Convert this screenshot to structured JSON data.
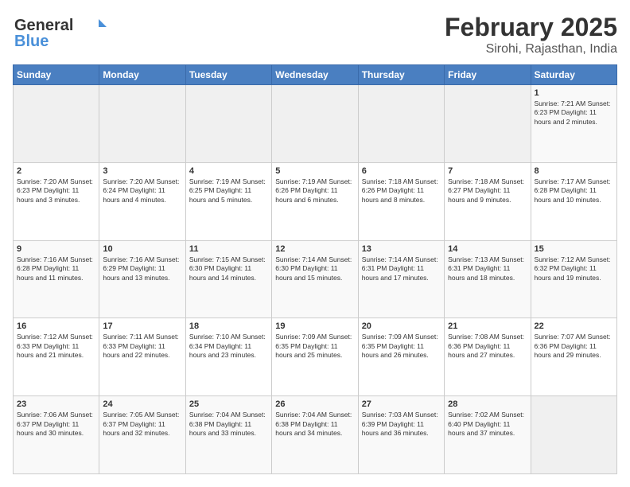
{
  "header": {
    "logo_line1": "General",
    "logo_line2": "Blue",
    "month": "February 2025",
    "location": "Sirohi, Rajasthan, India"
  },
  "weekdays": [
    "Sunday",
    "Monday",
    "Tuesday",
    "Wednesday",
    "Thursday",
    "Friday",
    "Saturday"
  ],
  "weeks": [
    [
      {
        "day": "",
        "info": ""
      },
      {
        "day": "",
        "info": ""
      },
      {
        "day": "",
        "info": ""
      },
      {
        "day": "",
        "info": ""
      },
      {
        "day": "",
        "info": ""
      },
      {
        "day": "",
        "info": ""
      },
      {
        "day": "1",
        "info": "Sunrise: 7:21 AM\nSunset: 6:23 PM\nDaylight: 11 hours\nand 2 minutes."
      }
    ],
    [
      {
        "day": "2",
        "info": "Sunrise: 7:20 AM\nSunset: 6:23 PM\nDaylight: 11 hours\nand 3 minutes."
      },
      {
        "day": "3",
        "info": "Sunrise: 7:20 AM\nSunset: 6:24 PM\nDaylight: 11 hours\nand 4 minutes."
      },
      {
        "day": "4",
        "info": "Sunrise: 7:19 AM\nSunset: 6:25 PM\nDaylight: 11 hours\nand 5 minutes."
      },
      {
        "day": "5",
        "info": "Sunrise: 7:19 AM\nSunset: 6:26 PM\nDaylight: 11 hours\nand 6 minutes."
      },
      {
        "day": "6",
        "info": "Sunrise: 7:18 AM\nSunset: 6:26 PM\nDaylight: 11 hours\nand 8 minutes."
      },
      {
        "day": "7",
        "info": "Sunrise: 7:18 AM\nSunset: 6:27 PM\nDaylight: 11 hours\nand 9 minutes."
      },
      {
        "day": "8",
        "info": "Sunrise: 7:17 AM\nSunset: 6:28 PM\nDaylight: 11 hours\nand 10 minutes."
      }
    ],
    [
      {
        "day": "9",
        "info": "Sunrise: 7:16 AM\nSunset: 6:28 PM\nDaylight: 11 hours\nand 11 minutes."
      },
      {
        "day": "10",
        "info": "Sunrise: 7:16 AM\nSunset: 6:29 PM\nDaylight: 11 hours\nand 13 minutes."
      },
      {
        "day": "11",
        "info": "Sunrise: 7:15 AM\nSunset: 6:30 PM\nDaylight: 11 hours\nand 14 minutes."
      },
      {
        "day": "12",
        "info": "Sunrise: 7:14 AM\nSunset: 6:30 PM\nDaylight: 11 hours\nand 15 minutes."
      },
      {
        "day": "13",
        "info": "Sunrise: 7:14 AM\nSunset: 6:31 PM\nDaylight: 11 hours\nand 17 minutes."
      },
      {
        "day": "14",
        "info": "Sunrise: 7:13 AM\nSunset: 6:31 PM\nDaylight: 11 hours\nand 18 minutes."
      },
      {
        "day": "15",
        "info": "Sunrise: 7:12 AM\nSunset: 6:32 PM\nDaylight: 11 hours\nand 19 minutes."
      }
    ],
    [
      {
        "day": "16",
        "info": "Sunrise: 7:12 AM\nSunset: 6:33 PM\nDaylight: 11 hours\nand 21 minutes."
      },
      {
        "day": "17",
        "info": "Sunrise: 7:11 AM\nSunset: 6:33 PM\nDaylight: 11 hours\nand 22 minutes."
      },
      {
        "day": "18",
        "info": "Sunrise: 7:10 AM\nSunset: 6:34 PM\nDaylight: 11 hours\nand 23 minutes."
      },
      {
        "day": "19",
        "info": "Sunrise: 7:09 AM\nSunset: 6:35 PM\nDaylight: 11 hours\nand 25 minutes."
      },
      {
        "day": "20",
        "info": "Sunrise: 7:09 AM\nSunset: 6:35 PM\nDaylight: 11 hours\nand 26 minutes."
      },
      {
        "day": "21",
        "info": "Sunrise: 7:08 AM\nSunset: 6:36 PM\nDaylight: 11 hours\nand 27 minutes."
      },
      {
        "day": "22",
        "info": "Sunrise: 7:07 AM\nSunset: 6:36 PM\nDaylight: 11 hours\nand 29 minutes."
      }
    ],
    [
      {
        "day": "23",
        "info": "Sunrise: 7:06 AM\nSunset: 6:37 PM\nDaylight: 11 hours\nand 30 minutes."
      },
      {
        "day": "24",
        "info": "Sunrise: 7:05 AM\nSunset: 6:37 PM\nDaylight: 11 hours\nand 32 minutes."
      },
      {
        "day": "25",
        "info": "Sunrise: 7:04 AM\nSunset: 6:38 PM\nDaylight: 11 hours\nand 33 minutes."
      },
      {
        "day": "26",
        "info": "Sunrise: 7:04 AM\nSunset: 6:38 PM\nDaylight: 11 hours\nand 34 minutes."
      },
      {
        "day": "27",
        "info": "Sunrise: 7:03 AM\nSunset: 6:39 PM\nDaylight: 11 hours\nand 36 minutes."
      },
      {
        "day": "28",
        "info": "Sunrise: 7:02 AM\nSunset: 6:40 PM\nDaylight: 11 hours\nand 37 minutes."
      },
      {
        "day": "",
        "info": ""
      }
    ]
  ]
}
